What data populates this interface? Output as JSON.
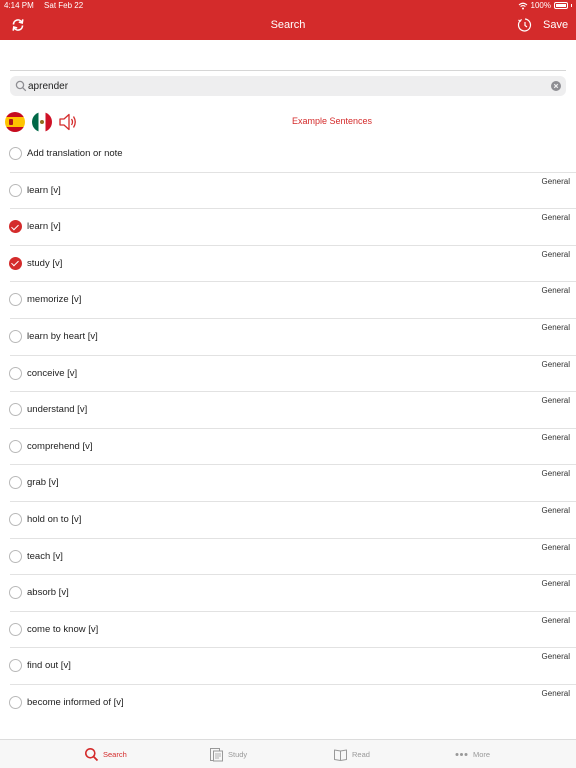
{
  "status": {
    "time": "4:14 PM",
    "date": "Sat Feb 22",
    "battery": "100%"
  },
  "header": {
    "title": "Search",
    "save_label": "Save"
  },
  "search": {
    "value": "aprender",
    "placeholder": ""
  },
  "controls": {
    "example_sentences": "Example Sentences"
  },
  "list": {
    "items": [
      {
        "label": "Add translation or note",
        "category": "",
        "checked": false
      },
      {
        "label": "learn [v]",
        "category": "General",
        "checked": false
      },
      {
        "label": "learn [v]",
        "category": "General",
        "checked": true
      },
      {
        "label": "study [v]",
        "category": "General",
        "checked": true
      },
      {
        "label": "memorize [v]",
        "category": "General",
        "checked": false
      },
      {
        "label": "learn by heart [v]",
        "category": "General",
        "checked": false
      },
      {
        "label": "conceive [v]",
        "category": "General",
        "checked": false
      },
      {
        "label": "understand [v]",
        "category": "General",
        "checked": false
      },
      {
        "label": "comprehend [v]",
        "category": "General",
        "checked": false
      },
      {
        "label": "grab [v]",
        "category": "General",
        "checked": false
      },
      {
        "label": "hold on to [v]",
        "category": "General",
        "checked": false
      },
      {
        "label": "teach [v]",
        "category": "General",
        "checked": false
      },
      {
        "label": "absorb [v]",
        "category": "General",
        "checked": false
      },
      {
        "label": "come to know [v]",
        "category": "General",
        "checked": false
      },
      {
        "label": "find out [v]",
        "category": "General",
        "checked": false
      },
      {
        "label": "become informed of [v]",
        "category": "General",
        "checked": false
      }
    ]
  },
  "tabs": [
    {
      "label": "Search",
      "icon": "search-icon",
      "active": true
    },
    {
      "label": "Study",
      "icon": "study-icon",
      "active": false
    },
    {
      "label": "Read",
      "icon": "book-icon",
      "active": false
    },
    {
      "label": "More",
      "icon": "more-icon",
      "active": false
    }
  ],
  "colors": {
    "accent": "#d42b2b",
    "divider": "#e2e2e2",
    "inactive_tab": "#999999"
  }
}
